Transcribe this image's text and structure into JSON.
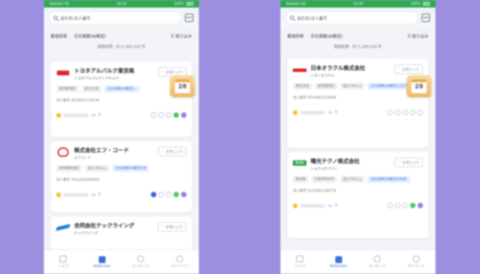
{
  "status_bar": {
    "carrier": "Rakuten 4G",
    "time": "16:30",
    "battery": "100%"
  },
  "search": {
    "placeholder": "会社名/法人番号"
  },
  "filters": {
    "left_1": "都道府県",
    "left_2": "正社員数(AI推定)",
    "right": "絞り込み"
  },
  "result_count": "検索結果：約 5,288,434 件",
  "calendar_day": "28",
  "left_cards": [
    {
      "name": "トヨタアルバルク東京株",
      "kana": "トヨタアルバルクトウキョウ",
      "fav": "お気に入り",
      "tags": [
        "東京都港区",
        "設立25年",
        "正社員数(AI推定)…"
      ],
      "corp_no": "法人番号 4010001178149",
      "msgs": "0"
    },
    {
      "name": "株式会社エフ・コード",
      "kana": "エフコード",
      "fav": "お気に入り",
      "tags": [
        "東京都新宿区",
        "設立7年以上",
        "正社員数(AI推定)38"
      ],
      "corp_no": "法人番号 7011001000803",
      "msgs": "0"
    },
    {
      "name": "合同会社テックライング",
      "kana": "テックライング",
      "fav": "お気に入り"
    }
  ],
  "right_cards": [
    {
      "name": "日本オラクル株式会社",
      "kana": "ニホンオラクル",
      "fav": "お気に入り",
      "tags": [
        "港区赤坂",
        "東京都港区",
        "設立7年以上",
        "正社員数(AI推定)2,527名"
      ],
      "corp_no": "法人番号 4010401078389",
      "msgs": "0"
    },
    {
      "name": "曙光テクノ株式会社",
      "kana": "ショウコウテクノ",
      "fav": "お気に入り",
      "tags": [
        "製造業",
        "大阪府吹田市",
        "設立7年以上",
        "正社員数(AI推定)440名"
      ],
      "corp_no": "法人番号 4120001148778",
      "msgs": "0"
    }
  ],
  "tabs": [
    "ジョブ",
    "Reflection",
    "メッセージ",
    "マイページ"
  ],
  "colors": {
    "status_green": "#2fa84f",
    "accent_blue": "#3b6fd8",
    "background": "#9d8fe0"
  }
}
